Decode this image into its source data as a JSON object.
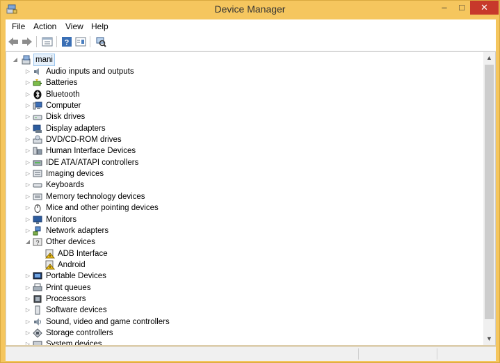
{
  "window": {
    "title": "Device Manager",
    "minimize": "–",
    "maximize": "□",
    "close": "✕"
  },
  "menu": [
    "File",
    "Action",
    "View",
    "Help"
  ],
  "toolbar": [
    "back-icon",
    "forward-icon",
    "properties-icon",
    "help-icon",
    "show-hidden-icon",
    "scan-hardware-icon"
  ],
  "tree": {
    "root": "mani",
    "categories": [
      {
        "label": "Audio inputs and outputs",
        "icon": "speaker-icon"
      },
      {
        "label": "Batteries",
        "icon": "battery-icon"
      },
      {
        "label": "Bluetooth",
        "icon": "bluetooth-icon"
      },
      {
        "label": "Computer",
        "icon": "computer-icon"
      },
      {
        "label": "Disk drives",
        "icon": "disk-drive-icon"
      },
      {
        "label": "Display adapters",
        "icon": "display-adapter-icon"
      },
      {
        "label": "DVD/CD-ROM drives",
        "icon": "dvd-drive-icon"
      },
      {
        "label": "Human Interface Devices",
        "icon": "hid-icon"
      },
      {
        "label": "IDE ATA/ATAPI controllers",
        "icon": "ide-controller-icon"
      },
      {
        "label": "Imaging devices",
        "icon": "camera-icon"
      },
      {
        "label": "Keyboards",
        "icon": "keyboard-icon"
      },
      {
        "label": "Memory technology devices",
        "icon": "memory-icon"
      },
      {
        "label": "Mice and other pointing devices",
        "icon": "mouse-icon"
      },
      {
        "label": "Monitors",
        "icon": "monitor-icon"
      },
      {
        "label": "Network adapters",
        "icon": "network-icon"
      },
      {
        "label": "Other devices",
        "icon": "unknown-device-icon",
        "expanded": true,
        "children": [
          {
            "label": "ADB Interface",
            "icon": "warning-device-icon"
          },
          {
            "label": "Android",
            "icon": "warning-device-icon"
          }
        ]
      },
      {
        "label": "Portable Devices",
        "icon": "portable-device-icon"
      },
      {
        "label": "Print queues",
        "icon": "printer-icon"
      },
      {
        "label": "Processors",
        "icon": "processor-icon"
      },
      {
        "label": "Software devices",
        "icon": "software-device-icon"
      },
      {
        "label": "Sound, video and game controllers",
        "icon": "sound-icon"
      },
      {
        "label": "Storage controllers",
        "icon": "storage-icon"
      },
      {
        "label": "System devices",
        "icon": "system-device-icon"
      }
    ]
  },
  "colors": {
    "frame": "#f5c65e",
    "close": "#c7392b",
    "selection": "#e5f0fb"
  }
}
